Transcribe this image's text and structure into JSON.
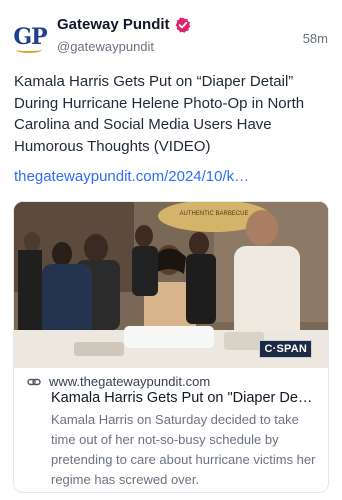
{
  "author": {
    "avatar_text": "GP",
    "display_name": "Gateway Pundit",
    "handle": "@gatewaypundit",
    "verified_icon": "verified-badge-icon",
    "verified_color": "#e0246b"
  },
  "post": {
    "time": "58m",
    "text": "Kamala Harris Gets Put on “Diaper Detail” During Hurricane Helene Photo-Op in North Carolina and Social Media Users Have Humorous Thoughts (VIDEO)",
    "link": "thegatewaypundit.com/2024/10/k…",
    "link_color": "#2f6df6"
  },
  "card": {
    "image_badge": "C·SPAN",
    "banner_text": "AUTHENTIC BARBECUE",
    "domain": "www.thegatewaypundit.com",
    "title": "Kamala Harris Gets Put on \"Diaper De…",
    "description": "Kamala Harris on Saturday decided to take time out of her not-so-busy schedule by pretending to care about hurricane victims her regime has screwed over.",
    "link_icon": "link-icon"
  }
}
